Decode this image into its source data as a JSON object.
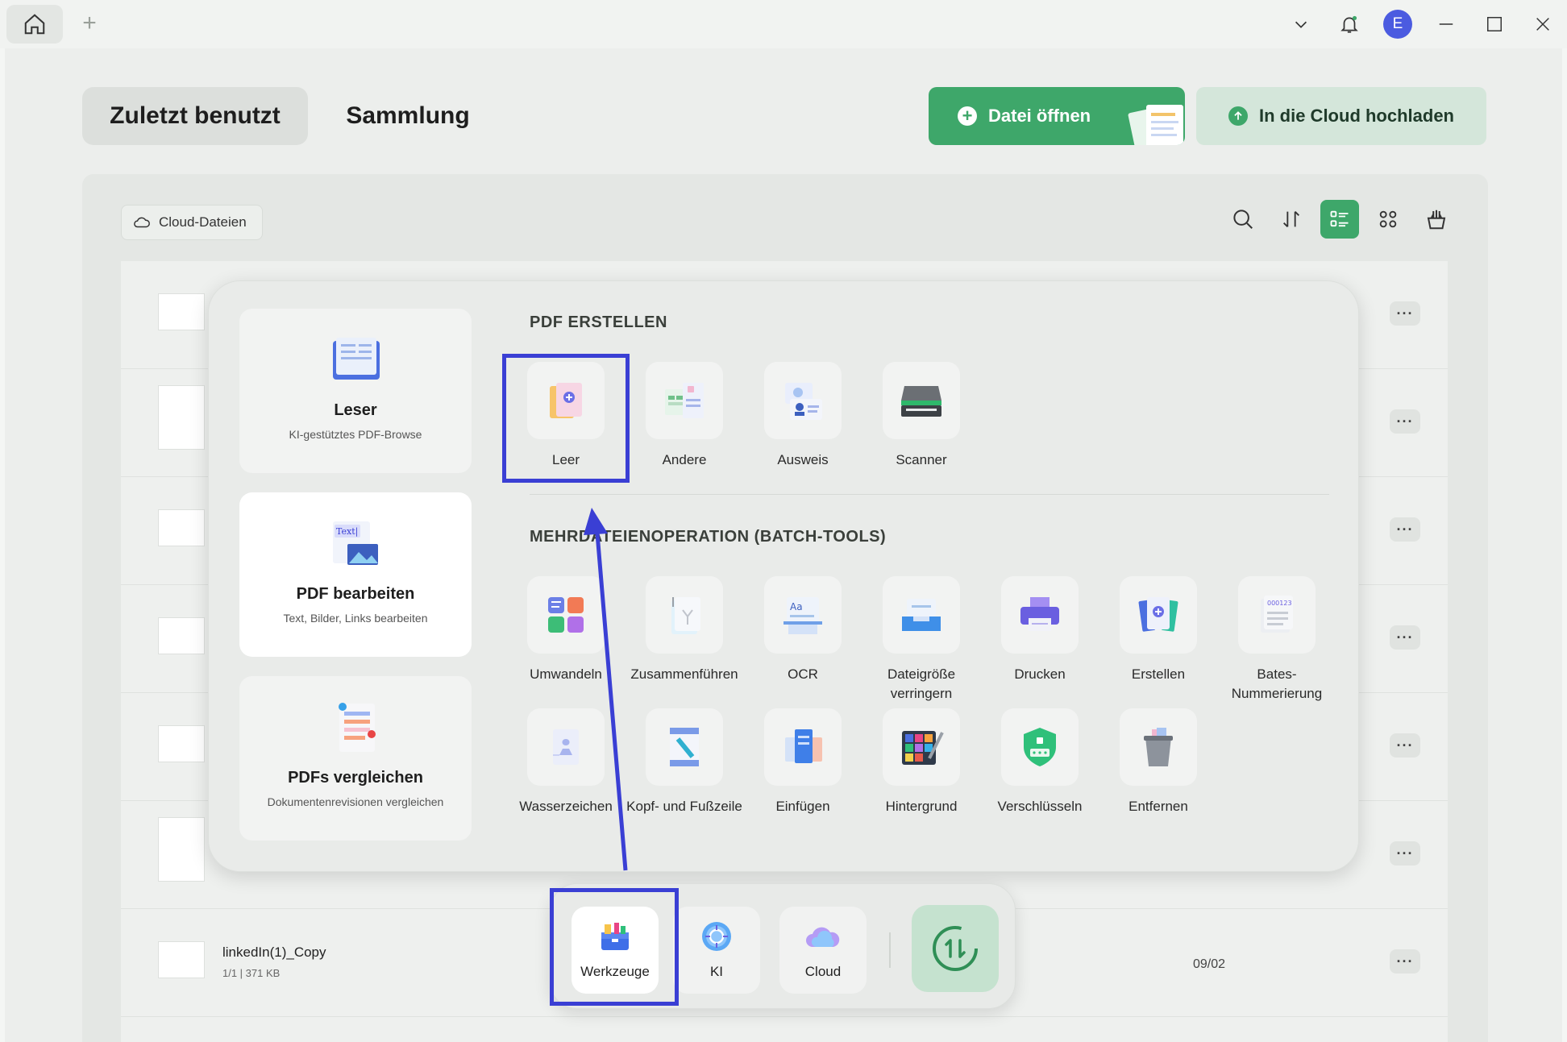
{
  "tabs": {
    "recent": "Zuletzt benutzt",
    "collection": "Sammlung"
  },
  "actions": {
    "open_file": "Datei öffnen",
    "upload_cloud": "In die Cloud hochladen"
  },
  "filter": {
    "cloud_files": "Cloud-Dateien"
  },
  "user": {
    "initial": "E"
  },
  "colors": {
    "accent": "#3ea76a",
    "highlight": "#3a3fd4",
    "avatar": "#4b5be0"
  },
  "features": [
    {
      "title": "Leser",
      "subtitle": "KI-gestütztes PDF-Browse"
    },
    {
      "title": "PDF bearbeiten",
      "subtitle": "Text, Bilder, Links bearbeiten",
      "icon_text": "Text|"
    },
    {
      "title": "PDFs vergleichen",
      "subtitle": "Dokumentenrevisionen vergleichen"
    }
  ],
  "sections": {
    "create": "PDF ERSTELLEN",
    "batch": "MEHRDATEIENOPERATION (BATCH-TOOLS)"
  },
  "create_tools": [
    {
      "label": "Leer",
      "icon": "blank-doc-icon"
    },
    {
      "label": "Andere",
      "icon": "other-docs-icon"
    },
    {
      "label": "Ausweis",
      "icon": "id-card-icon"
    },
    {
      "label": "Scanner",
      "icon": "scanner-icon"
    }
  ],
  "batch_tools_row1": [
    {
      "label": "Umwandeln",
      "icon": "convert-icon"
    },
    {
      "label": "Zusammenführen",
      "icon": "merge-icon"
    },
    {
      "label": "OCR",
      "icon": "ocr-icon"
    },
    {
      "label": "Dateigröße verringern",
      "icon": "compress-icon"
    },
    {
      "label": "Drucken",
      "icon": "printer-icon"
    },
    {
      "label": "Erstellen",
      "icon": "create-icon"
    },
    {
      "label": "Bates-Nummerierung",
      "icon": "bates-icon"
    }
  ],
  "batch_tools_row2": [
    {
      "label": "Wasserzeichen",
      "icon": "watermark-icon"
    },
    {
      "label": "Kopf- und Fußzeile",
      "icon": "header-footer-icon"
    },
    {
      "label": "Einfügen",
      "icon": "insert-icon"
    },
    {
      "label": "Hintergrund",
      "icon": "background-icon"
    },
    {
      "label": "Verschlüsseln",
      "icon": "encrypt-icon"
    },
    {
      "label": "Entfernen",
      "icon": "trash-icon"
    }
  ],
  "bates_badge": "000123",
  "ocr_badge": "Aa",
  "dock": {
    "tools": "Werkzeuge",
    "ai": "KI",
    "cloud": "Cloud"
  },
  "files": [
    {
      "name": "linkedIn(1)_Copy",
      "meta": "1/1 | 371 KB",
      "date": "09/02"
    }
  ]
}
